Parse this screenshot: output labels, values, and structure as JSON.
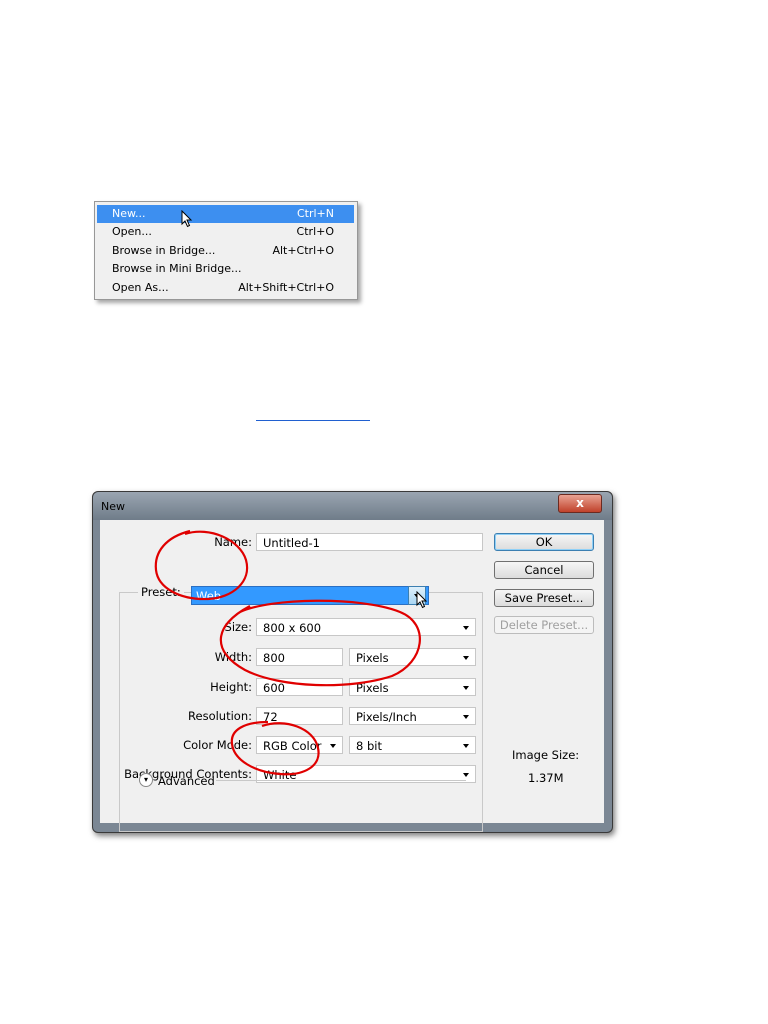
{
  "file_menu": {
    "items": [
      {
        "label": "New...",
        "shortcut": "Ctrl+N",
        "highlighted": true
      },
      {
        "label": "Open...",
        "shortcut": "Ctrl+O",
        "highlighted": false
      },
      {
        "label": "Browse in Bridge...",
        "shortcut": "Alt+Ctrl+O",
        "highlighted": false
      },
      {
        "label": "Browse in Mini Bridge...",
        "shortcut": "",
        "highlighted": false
      },
      {
        "label": "Open As...",
        "shortcut": "Alt+Shift+Ctrl+O",
        "highlighted": false
      }
    ]
  },
  "dialog": {
    "title": "New",
    "close_label": "x",
    "name_label": "Name:",
    "name_value": "Untitled-1",
    "preset_label": "Preset:",
    "preset_value": "Web",
    "size_label": "Size:",
    "size_value": "800 x 600",
    "width_label": "Width:",
    "width_value": "800",
    "width_unit": "Pixels",
    "height_label": "Height:",
    "height_value": "600",
    "height_unit": "Pixels",
    "resolution_label": "Resolution:",
    "resolution_value": "72",
    "resolution_unit": "Pixels/Inch",
    "color_mode_label": "Color Mode:",
    "color_mode_value": "RGB Color",
    "bit_depth_value": "8 bit",
    "background_label": "Background Contents:",
    "background_value": "White",
    "advanced_label": "Advanced",
    "buttons": {
      "ok": "OK",
      "cancel": "Cancel",
      "save_preset": "Save Preset...",
      "delete_preset": "Delete Preset..."
    },
    "image_size_label": "Image Size:",
    "image_size_value": "1.37M"
  },
  "colors": {
    "menu_highlight": "#3d8ff0",
    "annotation": "#e00000",
    "selection": "#3399ff"
  }
}
